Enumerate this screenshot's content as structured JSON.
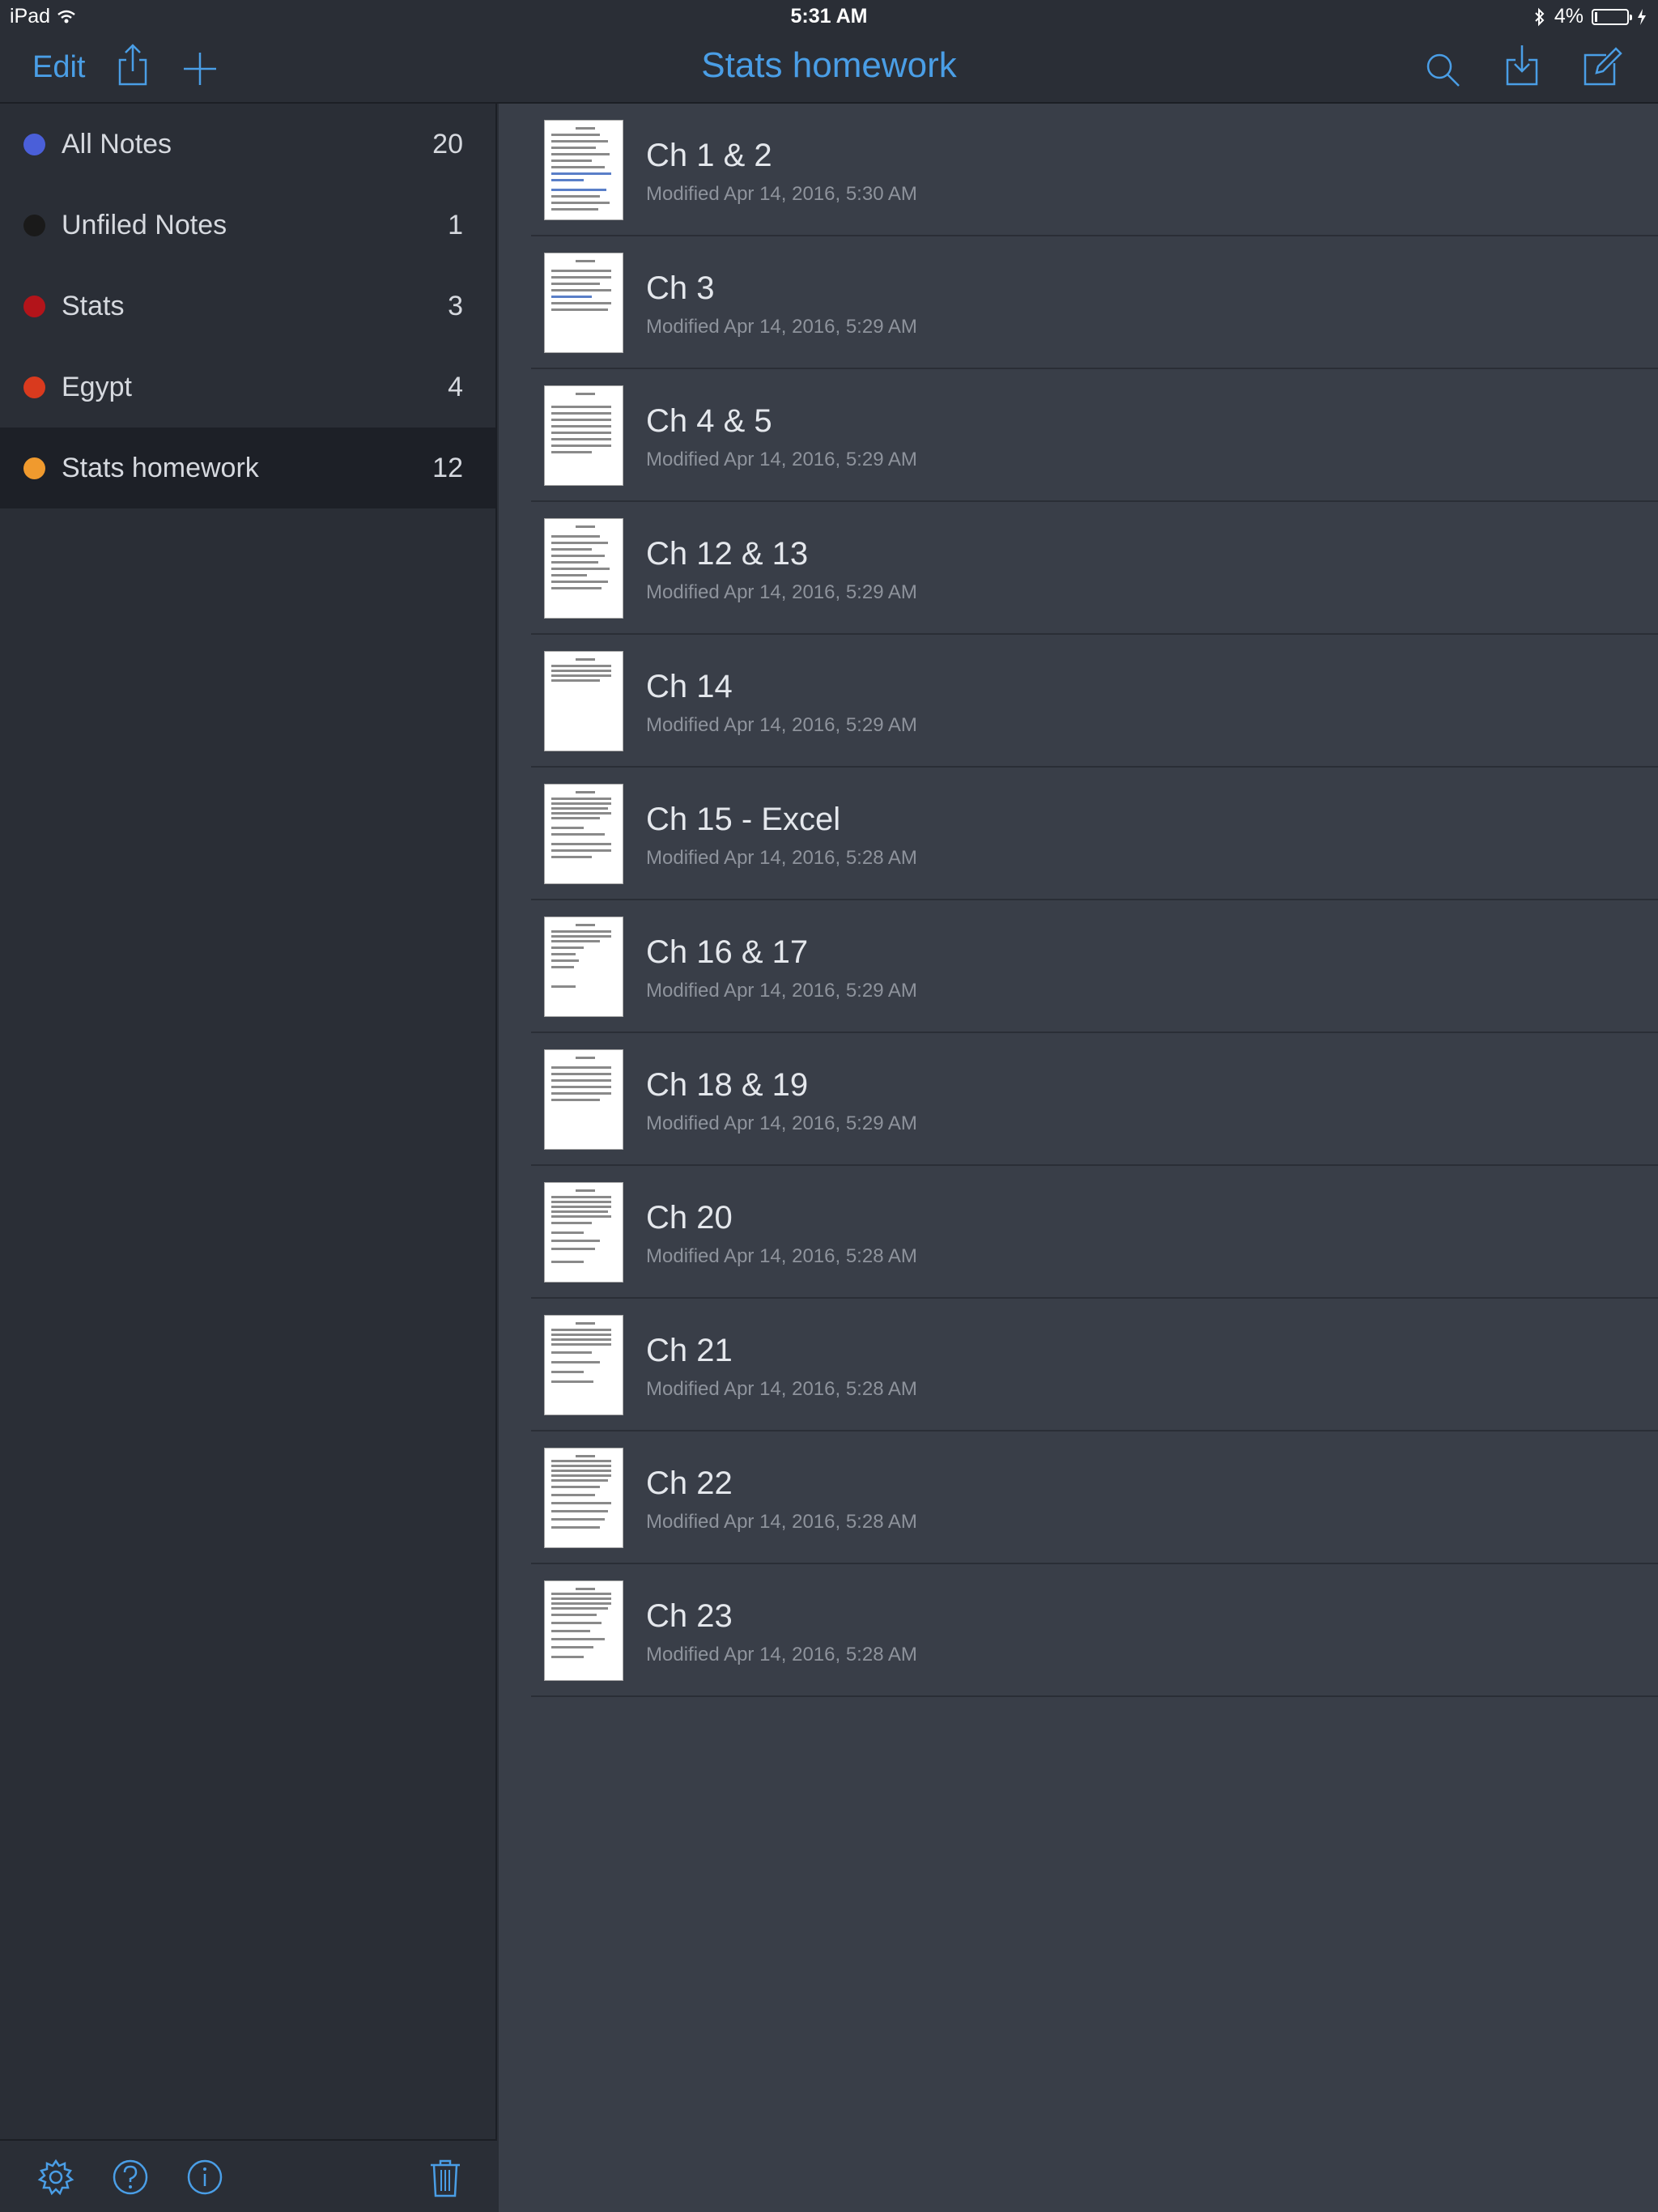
{
  "status_bar": {
    "device": "iPad",
    "time": "5:31 AM",
    "battery": "4%"
  },
  "nav": {
    "edit_label": "Edit",
    "title": "Stats homework"
  },
  "sidebar": {
    "folders": [
      {
        "name": "All Notes",
        "count": "20",
        "color": "#4a5fd9"
      },
      {
        "name": "Unfiled Notes",
        "count": "1",
        "color": "#1a1a1a"
      },
      {
        "name": "Stats",
        "count": "3",
        "color": "#b3141a"
      },
      {
        "name": "Egypt",
        "count": "4",
        "color": "#d93a1e"
      },
      {
        "name": "Stats homework",
        "count": "12",
        "color": "#f09a2e"
      }
    ],
    "selected_folder": "Stats homework"
  },
  "notes": [
    {
      "title": "Ch 1 & 2",
      "modified": "Modified Apr 14, 2016, 5:30 AM"
    },
    {
      "title": "Ch 3",
      "modified": "Modified Apr 14, 2016, 5:29 AM"
    },
    {
      "title": "Ch 4 & 5",
      "modified": "Modified Apr 14, 2016, 5:29 AM"
    },
    {
      "title": "Ch 12 & 13",
      "modified": "Modified Apr 14, 2016, 5:29 AM"
    },
    {
      "title": "Ch 14",
      "modified": "Modified Apr 14, 2016, 5:29 AM"
    },
    {
      "title": "Ch 15 - Excel",
      "modified": "Modified Apr 14, 2016, 5:28 AM"
    },
    {
      "title": "Ch 16 & 17",
      "modified": "Modified Apr 14, 2016, 5:29 AM"
    },
    {
      "title": "Ch 18 & 19",
      "modified": "Modified Apr 14, 2016, 5:29 AM"
    },
    {
      "title": "Ch 20",
      "modified": "Modified Apr 14, 2016, 5:28 AM"
    },
    {
      "title": "Ch 21",
      "modified": "Modified Apr 14, 2016, 5:28 AM"
    },
    {
      "title": "Ch 22",
      "modified": "Modified Apr 14, 2016, 5:28 AM"
    },
    {
      "title": "Ch 23",
      "modified": "Modified Apr 14, 2016, 5:28 AM"
    }
  ],
  "colors": {
    "accent": "#4a9ee6",
    "sidebar_bg": "#2a2e36",
    "list_bg": "#393e48",
    "selected_bg": "#1d2027"
  },
  "icons": {
    "nav_left": [
      "share-icon",
      "add-icon"
    ],
    "nav_right": [
      "search-icon",
      "import-icon",
      "compose-icon"
    ],
    "sidebar_toolbar": [
      "settings-icon",
      "help-icon",
      "info-icon",
      "trash-icon"
    ]
  }
}
